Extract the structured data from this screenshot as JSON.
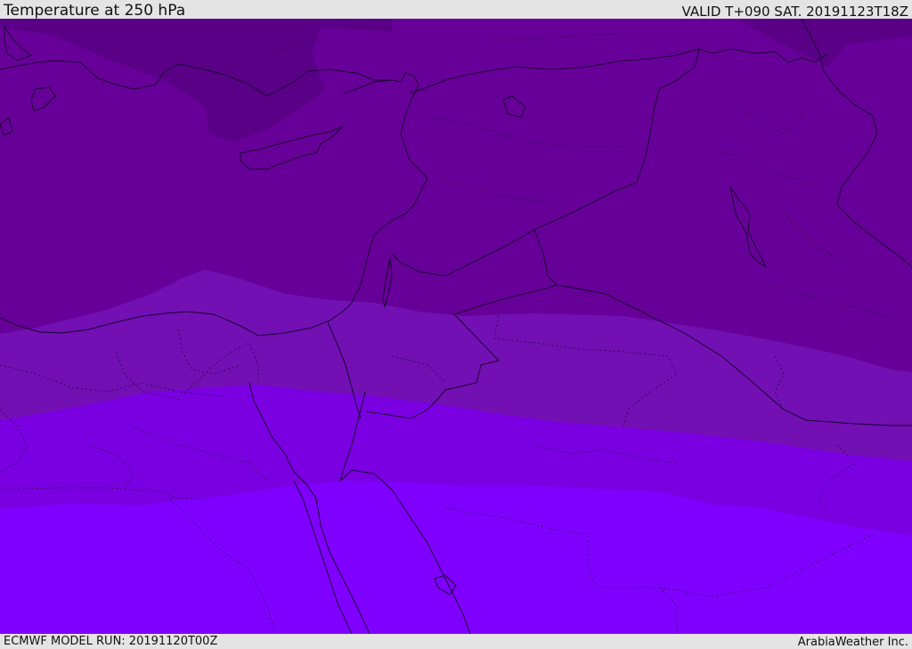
{
  "header": {
    "title": "Temperature at 250 hPa",
    "valid": "VALID T+090 SAT. 20191123T18Z"
  },
  "footer": {
    "model_run": "ECMWF MODEL RUN: 20191120T00Z",
    "credit": "ArabiaWeather Inc."
  },
  "colors": {
    "band_1": "#5a0087",
    "band_2": "#670098",
    "band_3": "#7210b4",
    "band_4": "#7a00e2",
    "band_5": "#8000ff",
    "coastline": "#1a0033",
    "frame": "#e4e4e4"
  }
}
